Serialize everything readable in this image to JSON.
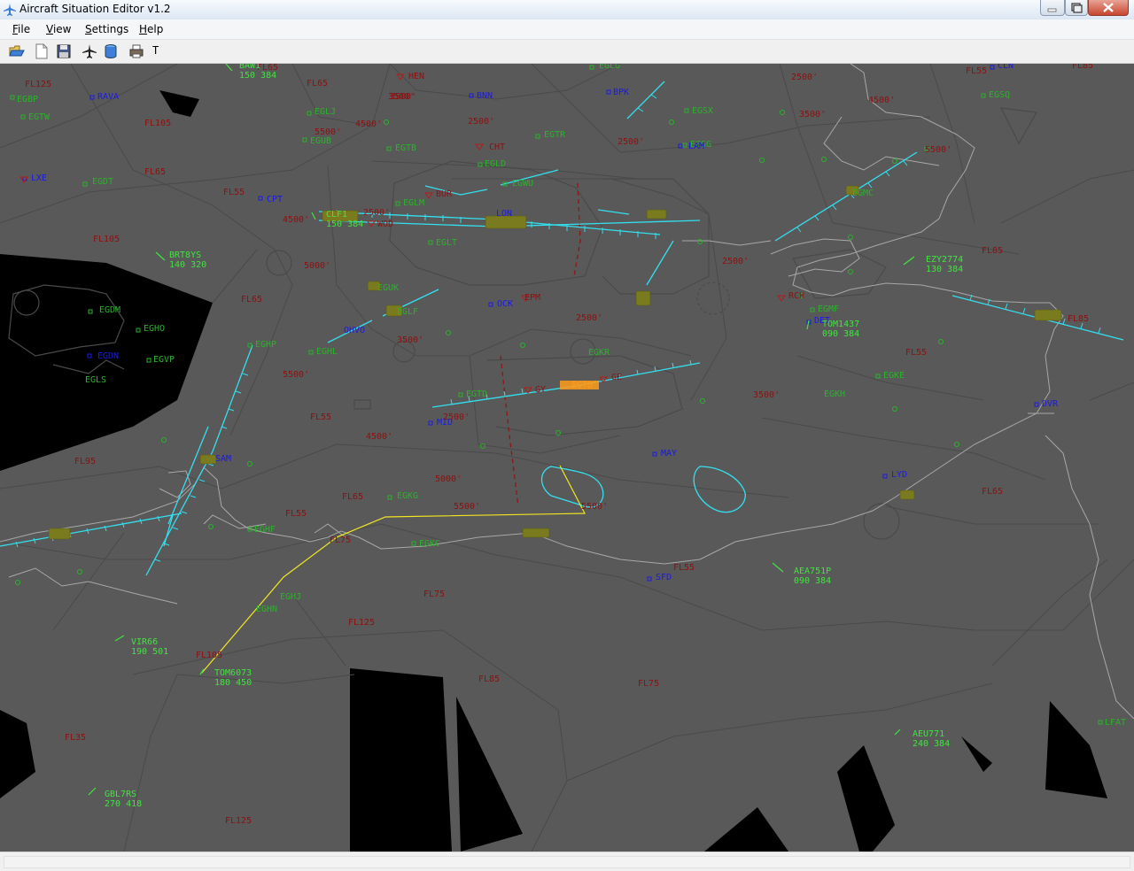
{
  "window": {
    "title": "Aircraft Situation Editor v1.2"
  },
  "menu": [
    {
      "label": "File",
      "u": "F",
      "rest": "ile"
    },
    {
      "label": "View",
      "u": "V",
      "rest": "iew"
    },
    {
      "label": "Settings",
      "u": "S",
      "rest": "ettings"
    },
    {
      "label": "Help",
      "u": "H",
      "rest": "elp"
    }
  ],
  "toolbar": {
    "buttons": [
      "open-icon",
      "new-icon",
      "save-icon",
      "aircraft-icon",
      "database-icon",
      "printer-icon"
    ],
    "text_button": "T"
  },
  "map": {
    "airports": [
      {
        "id": "EGBP"
      },
      {
        "id": "EGTW"
      },
      {
        "id": "EGDT"
      },
      {
        "id": "EGLJ"
      },
      {
        "id": "EGUB"
      },
      {
        "id": "EGTB"
      },
      {
        "id": "EGLD"
      },
      {
        "id": "EGWU"
      },
      {
        "id": "EGLM"
      },
      {
        "id": "EGLT"
      },
      {
        "id": "EGTR"
      },
      {
        "id": "EGSX"
      },
      {
        "id": "EGSG"
      },
      {
        "id": "EGSQ"
      },
      {
        "id": "EGMC"
      },
      {
        "id": "EGUK"
      },
      {
        "id": "EGLF"
      },
      {
        "id": "EGHL"
      },
      {
        "id": "EGHP"
      },
      {
        "id": "EGDM"
      },
      {
        "id": "EGHO"
      },
      {
        "id": "EGVP"
      },
      {
        "id": "EGLS"
      },
      {
        "id": "EGTD"
      },
      {
        "id": "EGKR"
      },
      {
        "id": "EGMF"
      },
      {
        "id": "EGKE"
      },
      {
        "id": "EGKH"
      },
      {
        "id": "EGKG"
      },
      {
        "id": "EGHF"
      },
      {
        "id": "EGKC"
      },
      {
        "id": "EGHJ"
      },
      {
        "id": "EGHN"
      },
      {
        "id": "LFAT"
      },
      {
        "id": "EGLG"
      }
    ],
    "vors": [
      {
        "id": "BNN"
      },
      {
        "id": "BPK"
      },
      {
        "id": "LAM"
      },
      {
        "id": "CPT"
      },
      {
        "id": "LON"
      },
      {
        "id": "OCK"
      },
      {
        "id": "DET"
      },
      {
        "id": "MID"
      },
      {
        "id": "MAY"
      },
      {
        "id": "LYD"
      },
      {
        "id": "DVR"
      },
      {
        "id": "SFD"
      },
      {
        "id": "LXE"
      },
      {
        "id": "RAVA"
      },
      {
        "id": "CLN"
      },
      {
        "id": "OHVO"
      },
      {
        "id": "SAM"
      },
      {
        "id": "EGDN"
      }
    ],
    "reporting": [
      {
        "id": "HEN"
      },
      {
        "id": "CHT"
      },
      {
        "id": "BUR"
      },
      {
        "id": "WOD"
      },
      {
        "id": "EPM"
      },
      {
        "id": "GY"
      },
      {
        "id": "GE"
      },
      {
        "id": "RCH"
      }
    ],
    "levels": [
      "FL125",
      "FL65",
      "FL105",
      "FL65",
      "FL55",
      "FL105",
      "FL65",
      "FL95",
      "FL55",
      "FL65",
      "FL55",
      "FL75",
      "FL75",
      "FL125",
      "FL105",
      "FL85",
      "FL75",
      "FL35",
      "FL125",
      "FL85",
      "FL55",
      "FL65",
      "FL85",
      "FL55",
      "FL55",
      "FL65",
      "FL85",
      "2500'",
      "4500'",
      "3500'",
      "2500'",
      "5500'",
      "4500'",
      "2500'",
      "4500'",
      "3500'",
      "5500'",
      "2500'",
      "5000'",
      "2500'",
      "3500'",
      "5500'",
      "2500'",
      "4500'",
      "5000'",
      "5500'",
      "3500'",
      "2500'",
      "5500'",
      "3500'"
    ],
    "aircraft": [
      {
        "cs": "BRT8YS",
        "data": "140 320"
      },
      {
        "cs": "EZY2774",
        "data": "130 384"
      },
      {
        "cs": "TOM1437",
        "data": "090 384"
      },
      {
        "cs": "AEA751P",
        "data": "090 384"
      },
      {
        "cs": "VIR66",
        "data": "190 501"
      },
      {
        "cs": "TOM6073",
        "data": "180 450"
      },
      {
        "cs": "AEU771",
        "data": "240 384"
      },
      {
        "cs": "GBL7RS",
        "data": "270 418"
      },
      {
        "cs": "CLF1",
        "data": "150 384"
      },
      {
        "cs": "BAW1",
        "data": "150 384"
      }
    ]
  },
  "colors": {
    "map_bg": "#595959",
    "void": "#000000",
    "airport": "#28b428",
    "vor": "#1a1ae6",
    "reporting": "#8e1010",
    "runway": "#33e0f0",
    "aircraft": "#3ee63e",
    "route": "#f2e61f",
    "selected": "#ff9b1a"
  }
}
